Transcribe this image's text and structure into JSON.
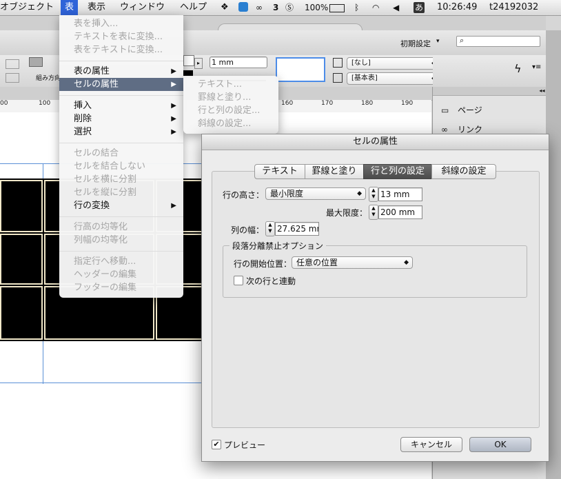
{
  "menubar": {
    "items": [
      "オブジェクト",
      "表",
      "表示",
      "ウィンドウ",
      "ヘルプ"
    ],
    "battery": "100%",
    "badge_count": "3",
    "ime": "あ",
    "clock": "10:26:49",
    "user": "t24192032"
  },
  "app": {
    "workspace": "初期設定",
    "stroke_weight": "1 mm",
    "style_none": "[なし]",
    "style_basic": "[基本表]",
    "ctrl_label": "組み方向",
    "ruler_ticks": [
      "00",
      "100",
      "160",
      "170",
      "180",
      "190"
    ]
  },
  "right_panel": {
    "items": [
      "ページ",
      "リンク"
    ]
  },
  "table_menu": {
    "items": [
      {
        "label": "表を挿入..."
      },
      {
        "label": "テキストを表に変換..."
      },
      {
        "label": "表をテキストに変換..."
      },
      {
        "label": "表の属性"
      },
      {
        "label": "セルの属性"
      },
      {
        "label": "挿入"
      },
      {
        "label": "削除"
      },
      {
        "label": "選択"
      },
      {
        "label": "セルの結合"
      },
      {
        "label": "セルを結合しない"
      },
      {
        "label": "セルを横に分割"
      },
      {
        "label": "セルを縦に分割"
      },
      {
        "label": "行の変換"
      },
      {
        "label": "行高の均等化"
      },
      {
        "label": "列幅の均等化"
      },
      {
        "label": "指定行へ移動..."
      },
      {
        "label": "ヘッダーの編集"
      },
      {
        "label": "フッターの編集"
      }
    ]
  },
  "submenu": {
    "items": [
      "テキスト...",
      "罫線と塗り...",
      "行と列の設定...",
      "斜線の設定..."
    ]
  },
  "dialog": {
    "title": "セルの属性",
    "tabs": [
      "テキスト",
      "罫線と塗り",
      "行と列の設定",
      "斜線の設定"
    ],
    "row_height_label": "行の高さ：",
    "row_height_mode": "最小限度",
    "row_height_value": "13 mm",
    "max_label": "最大限度：",
    "max_value": "200 mm",
    "col_width_label": "列の幅：",
    "col_width_value": "27.625 mm",
    "keep_group_title": "段落分離禁止オプション",
    "row_start_label": "行の開始位置：",
    "row_start_value": "任意の位置",
    "keep_with_next_label": "次の行と連動",
    "preview_label": "プレビュー",
    "cancel": "キャンセル",
    "ok": "OK"
  }
}
